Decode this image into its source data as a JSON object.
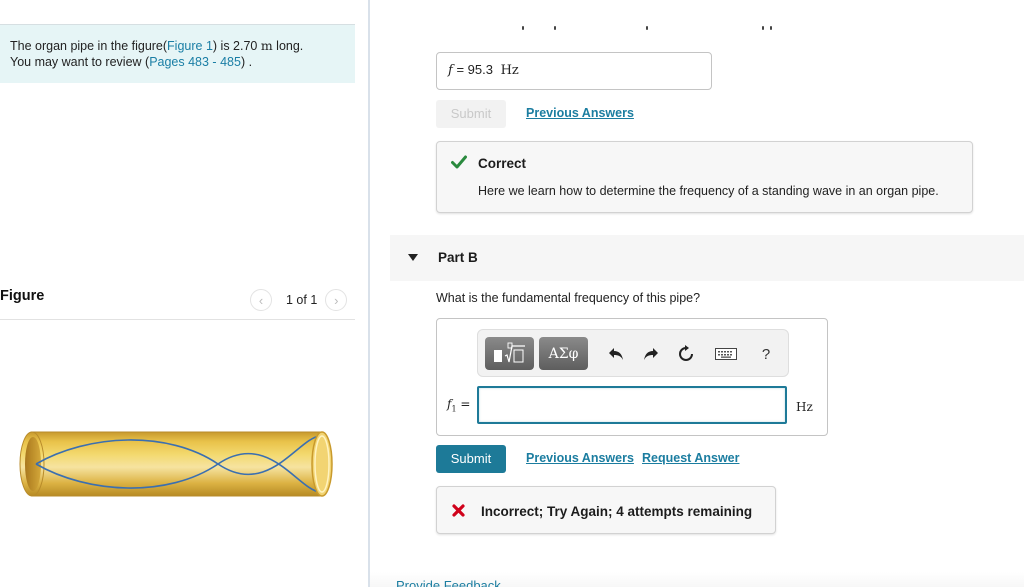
{
  "intro": {
    "text_before": "The organ pipe in the figure(",
    "figure_link": "Figure 1",
    "text_middle": ") is 2.70 ",
    "unit": "m",
    "text_after": " long.",
    "review_before": "You may want to review (",
    "pages_link": "Pages 483 - 485",
    "review_after": ") ."
  },
  "figure": {
    "title": "Figure",
    "pager_label": "1 of 1",
    "prev_icon": "chevron-left-icon",
    "next_icon": "chevron-right-icon",
    "image_description": "Gold open organ pipe with blue standing-wave envelope"
  },
  "part_a": {
    "answer_variable": "f",
    "answer_equals": "=",
    "answer_value": "95.3",
    "answer_unit": "Hz",
    "submit_label": "Submit",
    "previous_answers_label": "Previous Answers",
    "feedback": {
      "status": "Correct",
      "status_color": "#2a8a3e",
      "message": "Here we learn how to determine the frequency of a standing wave in an organ pipe."
    }
  },
  "part_b": {
    "title": "Part B",
    "question": "What is the fundamental frequency of this pipe?",
    "toolbar": {
      "templates_icon": "templates-icon",
      "greek_label": "ΑΣφ",
      "undo_icon": "undo-icon",
      "redo_icon": "redo-icon",
      "reset_icon": "reset-icon",
      "keyboard_icon": "keyboard-icon",
      "help_label": "?"
    },
    "variable_label": "f",
    "variable_subscript": "1",
    "equals": "=",
    "input_value": "",
    "unit": "Hz",
    "submit_label": "Submit",
    "previous_answers_label": "Previous Answers",
    "request_answer_label": "Request Answer",
    "feedback": {
      "status": "Incorrect; Try Again; 4 attempts remaining",
      "status_color": "#d0021b"
    }
  },
  "footer": {
    "provide_feedback_label": "Provide Feedback"
  },
  "colors": {
    "accent": "#1d7a98",
    "link": "#1b7da0",
    "intro_bg": "#e6f5f6"
  }
}
